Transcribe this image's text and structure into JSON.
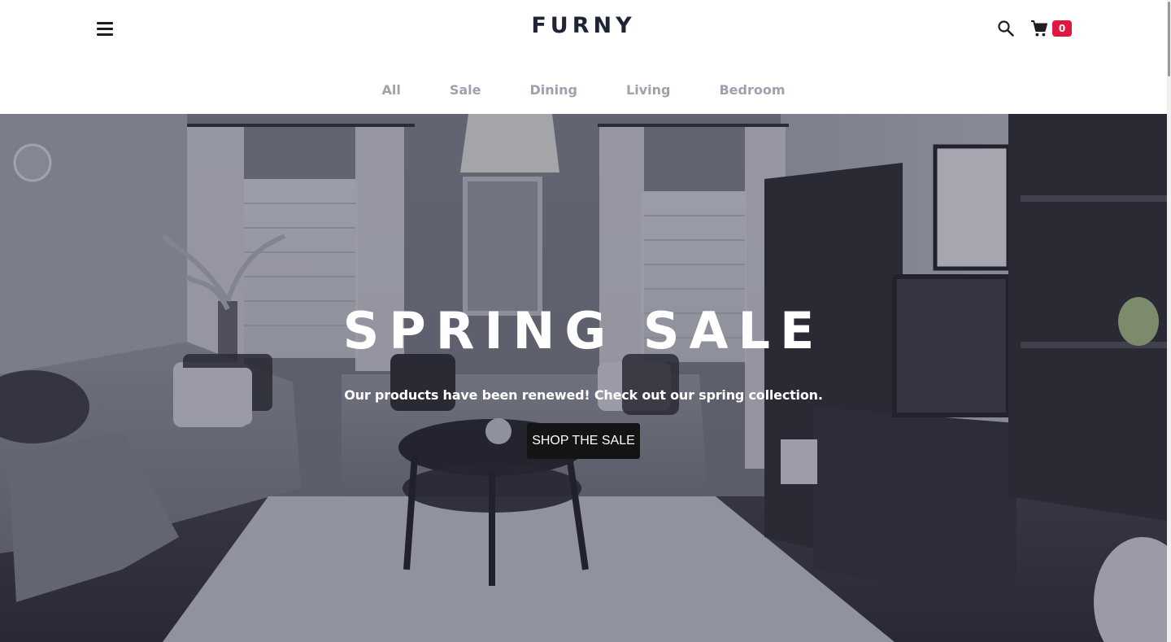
{
  "header": {
    "logo": "FURNY",
    "cart_count": "0"
  },
  "categories": [
    "All",
    "Sale",
    "Dining",
    "Living",
    "Bedroom"
  ],
  "hero": {
    "title": "SPRING SALE",
    "subtitle": "Our products have been renewed! Check out our spring collection.",
    "cta_label": "SHOP THE SALE"
  },
  "icons": {
    "menu": "hamburger-menu-icon",
    "search": "search-icon",
    "cart": "shopping-cart-icon"
  },
  "colors": {
    "brand_text": "#1d2534",
    "cart_badge": "#e0173f",
    "nav_text": "#9ca3ae",
    "cta_background": "#141414"
  }
}
